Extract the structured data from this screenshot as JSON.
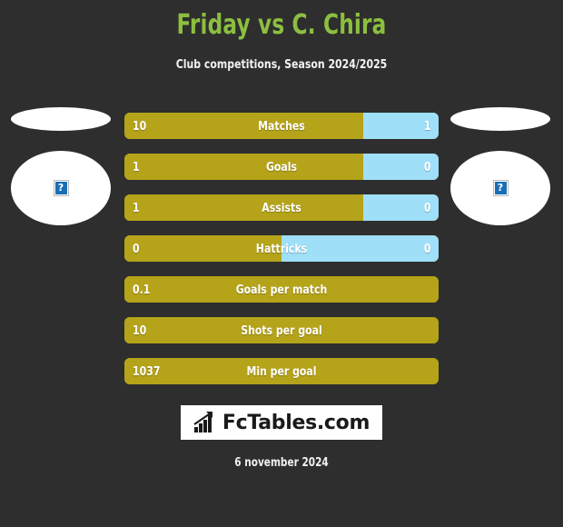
{
  "header": {
    "title": "Friday vs C. Chira",
    "subtitle": "Club competitions, Season 2024/2025",
    "title_color": "#8cbf3f",
    "background_color": "#2e2e2e"
  },
  "players": {
    "left": {
      "photo_placeholder_icon": "broken-image-icon",
      "placeholder_glyph": "?"
    },
    "right": {
      "photo_placeholder_icon": "broken-image-icon",
      "placeholder_glyph": "?"
    }
  },
  "colors": {
    "bar_left": "#b5a31a",
    "bar_right": "#9fdff8"
  },
  "chart_data": {
    "type": "bar",
    "title": "Friday vs C. Chira",
    "subtitle": "Club competitions, Season 2024/2025",
    "categories": [
      "Matches",
      "Goals",
      "Assists",
      "Hattricks",
      "Goals per match",
      "Shots per goal",
      "Min per goal"
    ],
    "series": [
      {
        "name": "Friday",
        "values": [
          "10",
          "1",
          "1",
          "0",
          "0.1",
          "10",
          "1037"
        ]
      },
      {
        "name": "C. Chira",
        "values": [
          "1",
          "0",
          "0",
          "0",
          "",
          "",
          ""
        ]
      }
    ],
    "legend_position": "none",
    "grid": false
  },
  "rows": [
    {
      "label": "Matches",
      "left_value": "10",
      "right_value": "1",
      "split_percent": 76,
      "has_right": true
    },
    {
      "label": "Goals",
      "left_value": "1",
      "right_value": "0",
      "split_percent": 76,
      "has_right": true
    },
    {
      "label": "Assists",
      "left_value": "1",
      "right_value": "0",
      "split_percent": 76,
      "has_right": true
    },
    {
      "label": "Hattricks",
      "left_value": "0",
      "right_value": "0",
      "split_percent": 50,
      "has_right": true
    },
    {
      "label": "Goals per match",
      "left_value": "0.1",
      "right_value": "",
      "split_percent": 100,
      "has_right": false
    },
    {
      "label": "Shots per goal",
      "left_value": "10",
      "right_value": "",
      "split_percent": 100,
      "has_right": false
    },
    {
      "label": "Min per goal",
      "left_value": "1037",
      "right_value": "",
      "split_percent": 100,
      "has_right": false
    }
  ],
  "logo": {
    "text": "FcTables.com",
    "icon": "bar-chart-arrow-icon"
  },
  "footer": {
    "date": "6 november 2024"
  }
}
